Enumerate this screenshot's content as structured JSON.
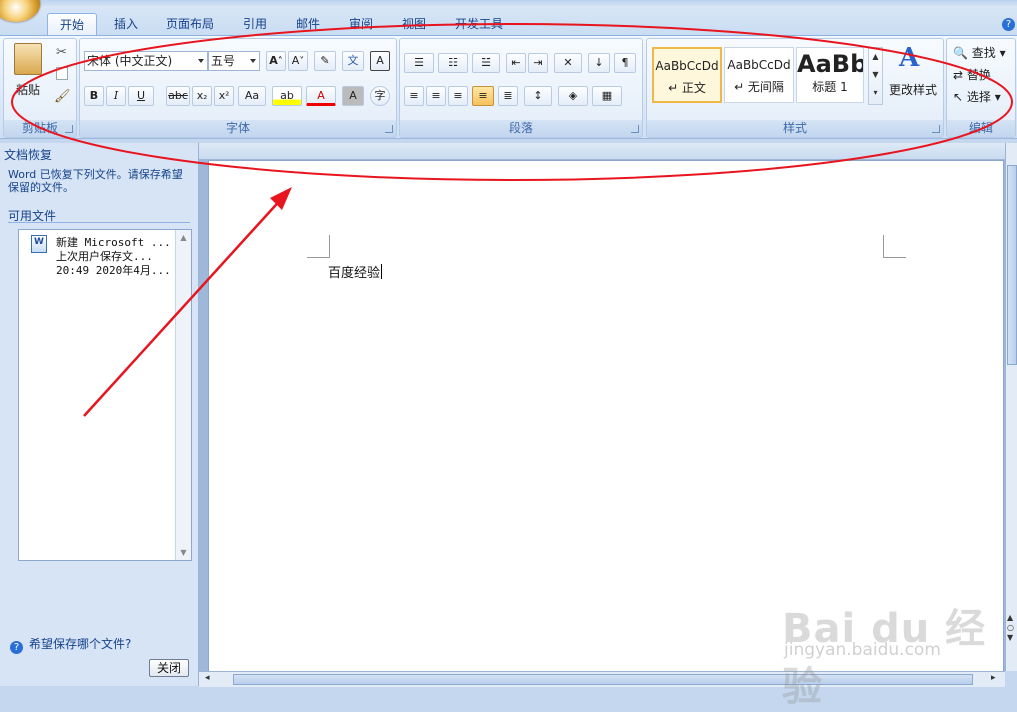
{
  "tabs": [
    "开始",
    "插入",
    "页面布局",
    "引用",
    "邮件",
    "审阅",
    "视图",
    "开发工具"
  ],
  "active_tab": "开始",
  "ribbon": {
    "clipboard": {
      "paste_label": "粘贴",
      "group_label": "剪贴板"
    },
    "font": {
      "font_name": "宋体 (中文正文)",
      "font_size": "五号",
      "group_label": "字体"
    },
    "paragraph": {
      "group_label": "段落"
    },
    "styles": {
      "items": [
        {
          "preview": "AaBbCcDd",
          "name": "↵ 正文"
        },
        {
          "preview": "AaBbCcDd",
          "name": "↵ 无间隔"
        },
        {
          "preview": "AaBb",
          "name": "标题 1"
        }
      ],
      "change_label": "更改样式",
      "group_label": "样式"
    },
    "editing": {
      "find": "查找",
      "replace": "替换",
      "select": "选择",
      "group_label": "编辑"
    }
  },
  "recovery_pane": {
    "title": "文档恢复",
    "description": "Word 已恢复下列文件。请保存希望保留的文件。",
    "available_label": "可用文件",
    "file": {
      "line1": "新建 Microsoft ...",
      "line2": "上次用户保存文...",
      "line3": "20:49 2020年4月..."
    },
    "help_link": "希望保存哪个文件?",
    "close_label": "关闭"
  },
  "document": {
    "text": "百度经验"
  },
  "watermark": {
    "logo_text": "Bai du 经验",
    "url": "jingyan.baidu.com"
  },
  "colors": {
    "annotation": "#e8141e",
    "ribbon_text": "#15428b"
  }
}
